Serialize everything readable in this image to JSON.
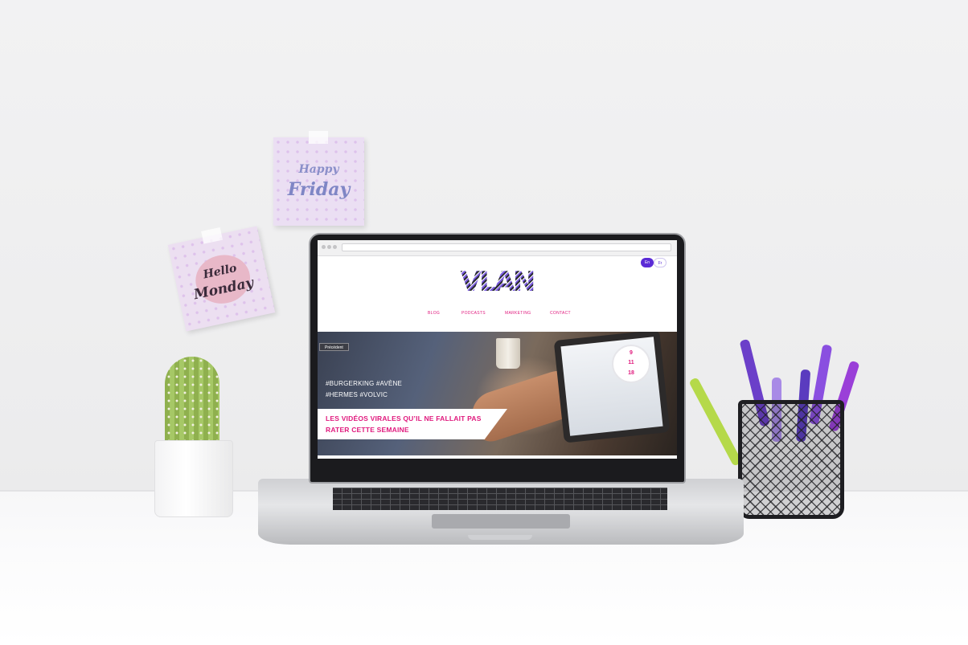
{
  "notes": {
    "friday_line1": "Happy",
    "friday_line2": "Friday",
    "monday_line1": "Hello",
    "monday_line2": "Monday"
  },
  "browser": {
    "lang_en": "En",
    "lang_fr": "Fr"
  },
  "site": {
    "logo": "VLAN",
    "nav": [
      "BLOG",
      "PODCASTS",
      "MARKETING",
      "CONTACT"
    ],
    "accent_color": "#e0197d",
    "brand_color": "#5b2bd6"
  },
  "hero": {
    "prev_label": "Précédent",
    "date": [
      "9",
      "11",
      "18"
    ],
    "tags_line1": "#BURGERKING #AVÈNE",
    "tags_line2": "#HERMES #VOLVIC",
    "headline_line1": "LES VIDÉOS VIRALES QU’IL NE FALLAIT PAS",
    "headline_line2": "RATER CETTE SEMAINE"
  }
}
